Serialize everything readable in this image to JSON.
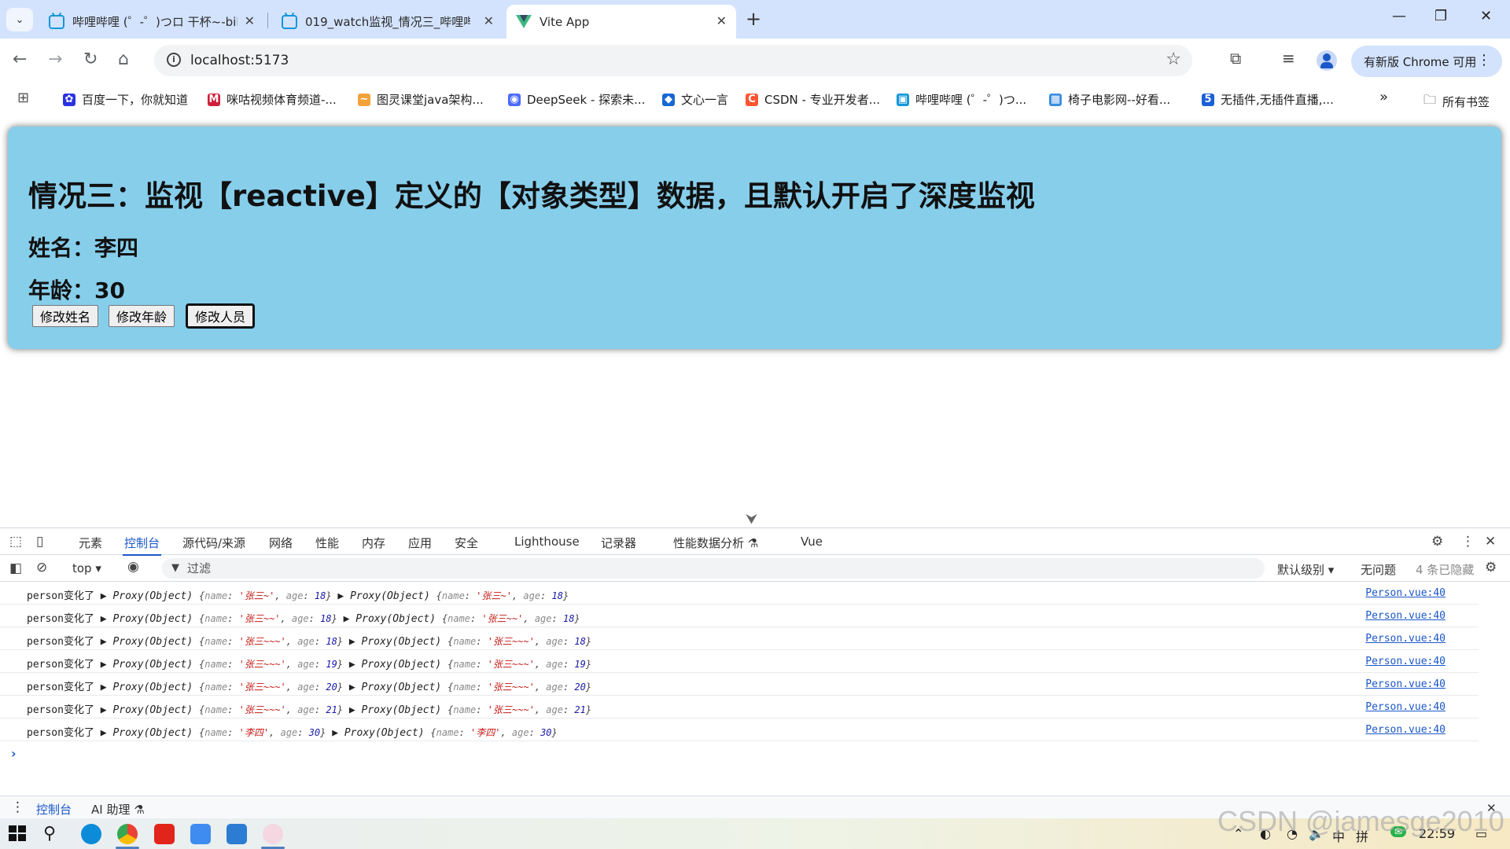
{
  "browser": {
    "tabs": [
      {
        "title": "哔哩哔哩 (゜-゜)つロ 干杯~-bili",
        "active": false
      },
      {
        "title": "019_watch监视_情况三_哔哩哔",
        "active": false
      },
      {
        "title": "Vite App",
        "active": true
      }
    ],
    "new_tab": "+",
    "window_controls": [
      "—",
      "❐",
      "✕"
    ],
    "url": "localhost:5173",
    "update_button": "有新版 Chrome 可用",
    "bookmarks": [
      "百度一下，你就知道",
      "咪咕视频体育频道-...",
      "图灵课堂java架构...",
      "DeepSeek - 探索未...",
      "文心一言",
      "CSDN - 专业开发者...",
      "哔哩哔哩 (゜-゜)つ...",
      "椅子电影网--好看...",
      "无插件,无插件直播,..."
    ],
    "bookmarks_more": "»",
    "all_bookmarks": "所有书签"
  },
  "page": {
    "heading": "情况三：监视【reactive】定义的【对象类型】数据，且默认开启了深度监视",
    "name_line": "姓名：李四",
    "age_line": "年龄：30",
    "buttons": [
      "修改姓名",
      "修改年龄",
      "修改人员"
    ]
  },
  "devtools": {
    "tabs": [
      "元素",
      "控制台",
      "源代码/来源",
      "网络",
      "性能",
      "内存",
      "应用",
      "安全",
      "Lighthouse",
      "记录器",
      "性能数据分析 ⚗",
      "Vue"
    ],
    "active_tab": "控制台",
    "context": "top ▾",
    "filter_placeholder": "过滤",
    "level": "默认级别 ▾",
    "issues": "无问题",
    "hidden": "4 条已隐藏",
    "logs": [
      {
        "label": "person变化了",
        "new_name": "'张三~'",
        "new_age": "18",
        "old_name": "'张三~'",
        "old_age": "18",
        "source": "Person.vue:40"
      },
      {
        "label": "person变化了",
        "new_name": "'张三~~'",
        "new_age": "18",
        "old_name": "'张三~~'",
        "old_age": "18",
        "source": "Person.vue:40"
      },
      {
        "label": "person变化了",
        "new_name": "'张三~~~'",
        "new_age": "18",
        "old_name": "'张三~~~'",
        "old_age": "18",
        "source": "Person.vue:40"
      },
      {
        "label": "person变化了",
        "new_name": "'张三~~~'",
        "new_age": "19",
        "old_name": "'张三~~~'",
        "old_age": "19",
        "source": "Person.vue:40"
      },
      {
        "label": "person变化了",
        "new_name": "'张三~~~'",
        "new_age": "20",
        "old_name": "'张三~~~'",
        "old_age": "20",
        "source": "Person.vue:40"
      },
      {
        "label": "person变化了",
        "new_name": "'张三~~~'",
        "new_age": "21",
        "old_name": "'张三~~~'",
        "old_age": "21",
        "source": "Person.vue:40"
      },
      {
        "label": "person变化了",
        "new_name": "'李四'",
        "new_age": "30",
        "old_name": "'李四'",
        "old_age": "30",
        "source": "Person.vue:40"
      }
    ],
    "proxy_label": "Proxy(Object)",
    "key_name": "name",
    "key_age": "age",
    "prompt": "›",
    "drawer_tabs": [
      "控制台",
      "AI 助理 ⚗"
    ]
  },
  "taskbar": {
    "ime": "中",
    "ime2": "拼",
    "clock": "22:59"
  },
  "watermark": "CSDN @jamesge2010",
  "colors": {
    "card_bg": "#87ceeb",
    "tab_strip": "#d3e3fd",
    "accent": "#1a57c8",
    "string_red": "#c41a16",
    "number_blue": "#1a1aa6"
  }
}
